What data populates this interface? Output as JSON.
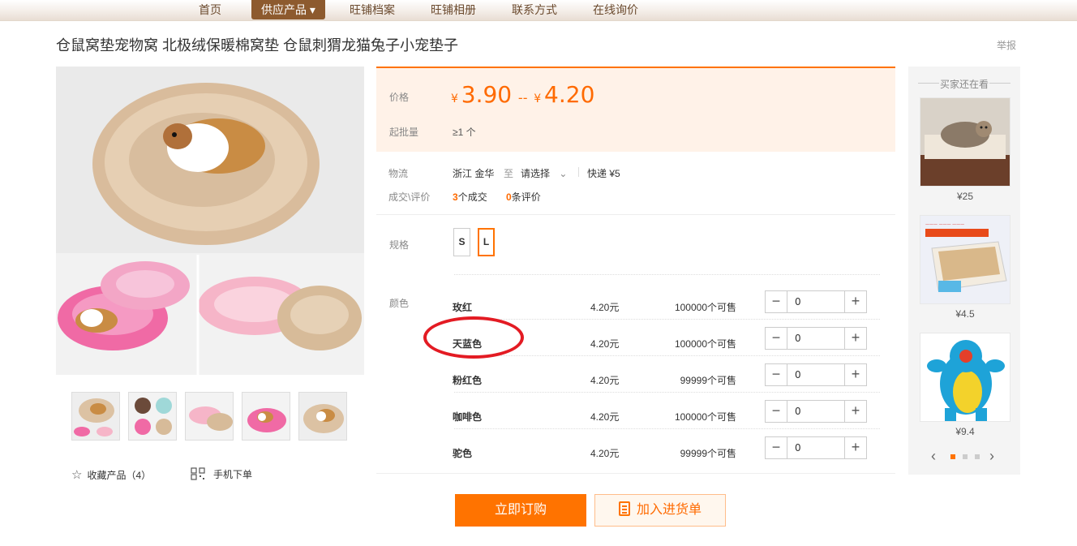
{
  "nav": {
    "items": [
      "首页",
      "供应产品 ▾",
      "旺铺档案",
      "旺铺相册",
      "联系方式",
      "在线询价"
    ]
  },
  "product": {
    "title": "仓鼠窝垫宠物窝 北极绒保暖棉窝垫 仓鼠刺猬龙猫兔子小宠垫子",
    "report": "举报",
    "thumb_count": 5,
    "favorite_label": "收藏产品（4）",
    "mobile_order_label": "手机下单"
  },
  "pricing": {
    "price_label": "价格",
    "currency": "¥",
    "price_low": "3.90",
    "range_sep": "--",
    "price_high": "4.20",
    "moq_label": "起批量",
    "moq_value": "≥1 个"
  },
  "logistics": {
    "label": "物流",
    "origin": "浙江 金华",
    "to": "至",
    "destination": "请选择",
    "shipping": "快递 ¥5"
  },
  "deals": {
    "label": "成交\\评价",
    "deal_count": "3",
    "deal_text": "个成交",
    "review_count": "0",
    "review_text": "条评价"
  },
  "spec": {
    "label": "规格",
    "options": [
      "S",
      "L"
    ],
    "selected": "L"
  },
  "colors": {
    "label": "颜色",
    "rows": [
      {
        "name": "玫红",
        "price": "4.20元",
        "stock": "100000个可售",
        "qty": "0"
      },
      {
        "name": "天蓝色",
        "price": "4.20元",
        "stock": "100000个可售",
        "qty": "0"
      },
      {
        "name": "粉红色",
        "price": "4.20元",
        "stock": "99999个可售",
        "qty": "0"
      },
      {
        "name": "咖啡色",
        "price": "4.20元",
        "stock": "100000个可售",
        "qty": "0"
      },
      {
        "name": "驼色",
        "price": "4.20元",
        "stock": "99999个可售",
        "qty": "0"
      }
    ]
  },
  "actions": {
    "buy": "立即订购",
    "cart": "加入进货单"
  },
  "sidebar": {
    "title": "买家还在看",
    "items": [
      {
        "price": "¥25",
        "image": "cat-on-hammock"
      },
      {
        "price": "¥4.5",
        "image": "pet-mat-box"
      },
      {
        "price": "¥9.4",
        "image": "blue-plush-toy"
      }
    ],
    "carousel_pages": 3,
    "carousel_active": 0
  },
  "colors_theme": {
    "accent": "#ff7300",
    "price_bg": "#fff2e8",
    "annotation": "#e31b23"
  }
}
